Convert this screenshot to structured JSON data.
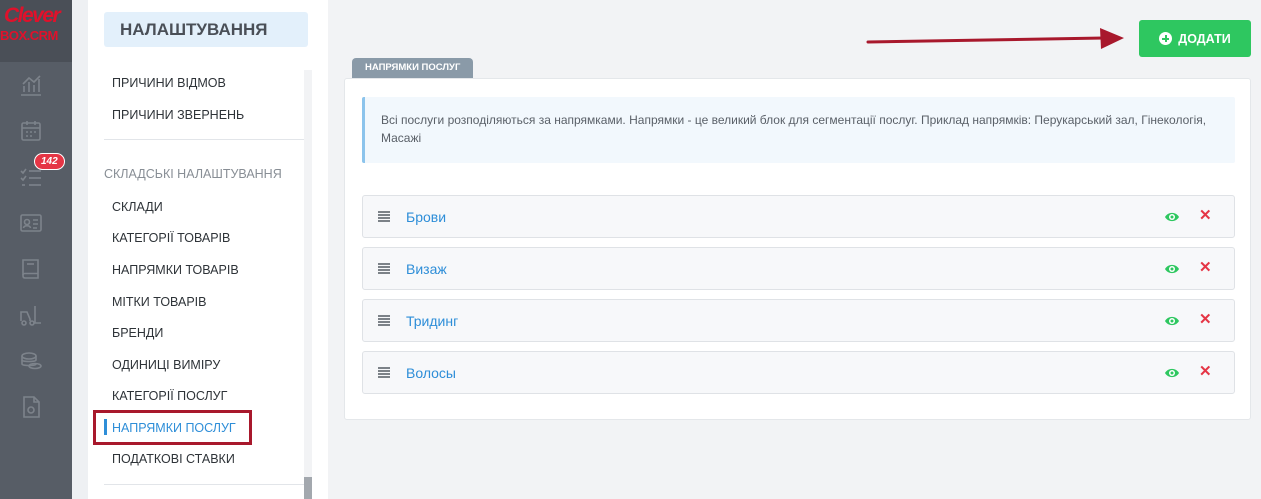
{
  "brand": {
    "logo_main": "Clever",
    "logo_sub": "BOX.CRM"
  },
  "rail": {
    "icons": [
      "analytics-icon",
      "calendar-icon",
      "tasks-icon",
      "contacts-card-icon",
      "book-icon",
      "forklift-icon",
      "coins-icon",
      "document-icon"
    ],
    "tasks_badge": "142"
  },
  "sidebar": {
    "title": "НАЛАШТУВАННЯ",
    "top_items": [
      "ПРИЧИНИ ВІДМОВ",
      "ПРИЧИНИ ЗВЕРНЕНЬ"
    ],
    "group_label": "СКЛАДСЬКІ НАЛАШТУВАННЯ",
    "items": [
      "СКЛАДИ",
      "КАТЕГОРІЇ ТОВАРІВ",
      "НАПРЯМКИ ТОВАРІВ",
      "МІТКИ ТОВАРІВ",
      "БРЕНДИ",
      "ОДИНИЦІ ВИМІРУ",
      "КАТЕГОРІЇ ПОСЛУГ",
      "НАПРЯМКИ ПОСЛУГ",
      "ПОДАТКОВІ СТАВКИ"
    ],
    "active_item": "НАПРЯМКИ ПОСЛУГ"
  },
  "toolbar": {
    "add_label": "ДОДАТИ"
  },
  "section": {
    "tab_label": "НАПРЯМКИ ПОСЛУГ",
    "info_text": "Всі послуги розподіляються за напрямками. Напрямки - це великий блок для сегментації послуг. Приклад напрямків: Перукарський зал, Гінекологія, Масажі",
    "rows": [
      {
        "name": "Брови"
      },
      {
        "name": "Визаж"
      },
      {
        "name": "Тридинг"
      },
      {
        "name": "Волосы"
      }
    ]
  },
  "colors": {
    "accent_blue": "#2e8ed8",
    "success_green": "#2ec760",
    "danger_red": "#e53545",
    "annotation_red": "#a8182c",
    "rail_bg": "#575d66"
  }
}
